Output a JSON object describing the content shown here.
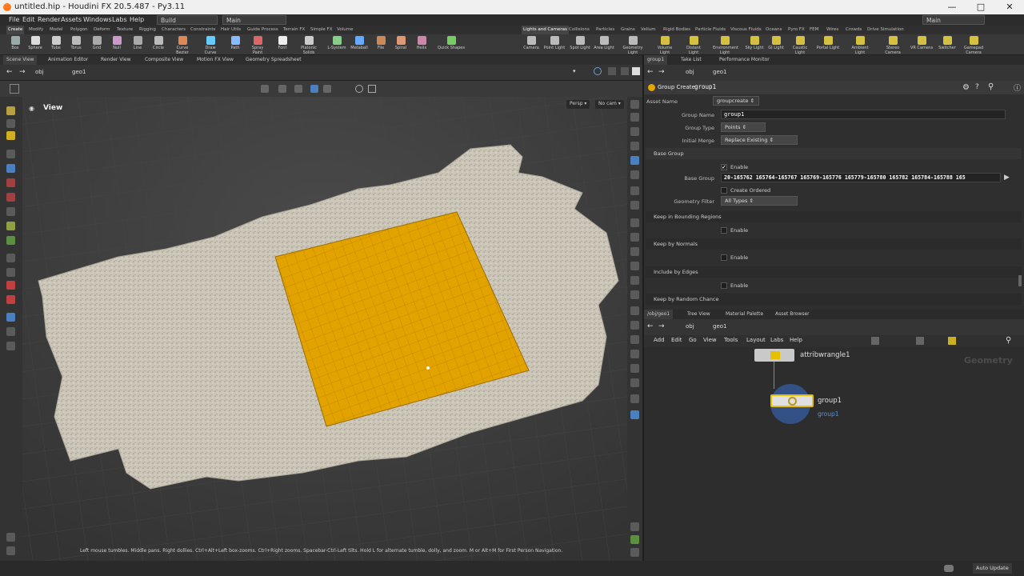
{
  "window": {
    "title": "untitled.hip - Houdini FX 20.5.487 - Py3.11"
  },
  "menu": {
    "items": [
      "File",
      "Edit",
      "Render",
      "Assets",
      "Windows",
      "Labs",
      "Help"
    ],
    "desktop": "Build",
    "main": "Main",
    "right_desktop": "Main"
  },
  "shelf_tabs_left": [
    "Create",
    "Modify",
    "Model",
    "Polygon",
    "Deform",
    "Texture",
    "Rigging",
    "Characters",
    "Constraints",
    "Hair Utils",
    "Guide Process",
    "Terrain FX",
    "Simple FX",
    "Volume"
  ],
  "shelf_tabs_right": [
    "Lights and Cameras",
    "Collisions",
    "Particles",
    "Grains",
    "Vellum",
    "Rigid Bodies",
    "Particle Fluids",
    "Viscous Fluids",
    "Oceans",
    "Pyro FX",
    "FEM",
    "Wires",
    "Crowds",
    "Drive Simulation"
  ],
  "tools_left": [
    "Box",
    "Sphere",
    "Tube",
    "Torus",
    "Grid",
    "Null",
    "Line",
    "Circle",
    "Curve Bezier",
    "Draw Curve",
    "Path",
    "Spray Paint",
    "Font",
    "Platonic Solids",
    "L-System",
    "Metaball",
    "File",
    "Spiral",
    "Helix",
    "Quick Shapes"
  ],
  "tools_right": [
    "Camera",
    "Point Light",
    "Spot Light",
    "Area Light",
    "Geometry Light",
    "Volume Light",
    "Distant Light",
    "Environment Light",
    "Sky Light",
    "GI Light",
    "Caustic Light",
    "Portal Light",
    "Ambient Light",
    "Stereo Camera",
    "VR Camera",
    "Switcher",
    "Gamepad Camera"
  ],
  "left_panel_tabs": [
    "Scene View",
    "Animation Editor",
    "Render View",
    "Composite View",
    "Motion FX View",
    "Geometry Spreadsheet"
  ],
  "path": {
    "root": "obj",
    "node": "geo1"
  },
  "viewport": {
    "title": "View",
    "camera": "Persp",
    "cam_menu": "No cam",
    "hint": "Left mouse tumbles. Middle pans. Right dollies. Ctrl+Alt+Left box-zooms. Ctrl+Right zooms. Spacebar-Ctrl-Left tilts. Hold L for alternate tumble, dolly, and zoom. M or Alt+M for First Person Navigation."
  },
  "right_tabs": [
    "group1",
    "Take List",
    "Performance Monitor"
  ],
  "params": {
    "node_type": "Group Create",
    "node_name": "group1",
    "asset_name_label": "Asset Name",
    "asset_name": "groupcreate",
    "group_name_label": "Group Name",
    "group_name": "group1",
    "group_type_label": "Group Type",
    "group_type": "Points",
    "initial_merge_label": "Initial Merge",
    "initial_merge": "Replace Existing",
    "section_base": "Base Group",
    "enable": "Enable",
    "base_group_label": "Base Group",
    "base_group": "20-165762 165764-165767 165769-165776 165779-165780 165782 165784-165788 165",
    "create_ordered": "Create Ordered",
    "geo_filter_label": "Geometry Filter",
    "geo_filter": "All Types",
    "section_bounding": "Keep in Bounding Regions",
    "section_normals": "Keep by Normals",
    "section_edges": "Include by Edges",
    "section_random": "Keep by Random Chance"
  },
  "network": {
    "tabs": [
      "/obj/geo1",
      "Tree View",
      "Material Palette",
      "Asset Browser"
    ],
    "menu": [
      "Add",
      "Edit",
      "Go",
      "View",
      "Tools",
      "Layout",
      "Labs",
      "Help"
    ],
    "context": "Geometry",
    "node1": "attribwrangle1",
    "node2": "group1",
    "node2_sub": "group1"
  },
  "status": {
    "auto_update": "Auto Update"
  },
  "colors": {
    "accent": "#e6a500",
    "node_ring": "#3a6fd0",
    "ground": "#c8c2b6"
  }
}
